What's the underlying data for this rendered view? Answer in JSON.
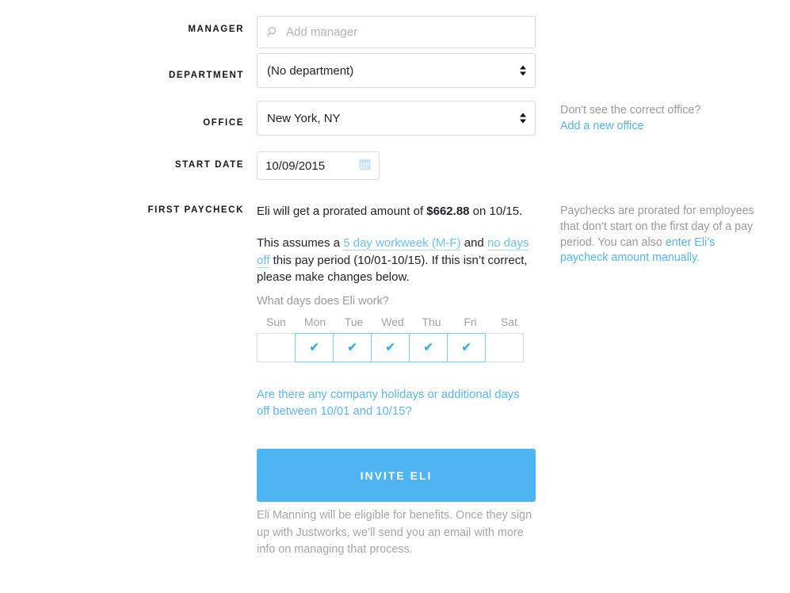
{
  "form": {
    "manager": {
      "label": "MANAGER",
      "placeholder": "Add manager",
      "value": "",
      "icon": "search-icon"
    },
    "department": {
      "label": "DEPARTMENT",
      "value": "(No department)",
      "options": [
        "(No department)"
      ]
    },
    "office": {
      "label": "OFFICE",
      "value": "New York, NY",
      "options": [
        "New York, NY"
      ],
      "helper_text": "Don't see the correct office?",
      "helper_link": "Add a new office"
    },
    "start_date": {
      "label": "START DATE",
      "value": "10/09/2015",
      "icon": "calendar-icon"
    },
    "first_paycheck": {
      "label": "FIRST PAYCHECK",
      "summary_prefix": "Eli will get a prorated amount of ",
      "summary_amount": "$662.88",
      "summary_suffix": " on 10/15.",
      "assumes_prefix": "This assumes a ",
      "workweek_link": "5 day workweek (M-F)",
      "assumes_mid": " and ",
      "daysoff_link": "no days off",
      "assumes_suffix": " this pay period (10/01-10/15). If this isn’t correct, please make changes below.",
      "helper_text_1": "Paychecks are prorated for employees that don’t start on the first day of a pay period. You can also ",
      "helper_link": "enter Eli’s paycheck amount manually.",
      "days_question": "What days does Eli work?",
      "days": [
        {
          "label": "Sun",
          "checked": false
        },
        {
          "label": "Mon",
          "checked": true
        },
        {
          "label": "Tue",
          "checked": true
        },
        {
          "label": "Wed",
          "checked": true
        },
        {
          "label": "Thu",
          "checked": true
        },
        {
          "label": "Fri",
          "checked": true
        },
        {
          "label": "Sat",
          "checked": false
        }
      ],
      "check_glyph": "✔",
      "holidays_link": "Are there any company holidays or additional days off between 10/01 and 10/15?"
    }
  },
  "submit": {
    "button_label": "INVITE ELI",
    "footnote": "Eli Manning will be eligible for benefits. Once they sign up with Justworks, we’ll send you an email with more info on managing that process."
  },
  "colors": {
    "accent": "#4fb4f2",
    "link": "#55b4f2",
    "muted": "#9a9a9a",
    "border": "#dcdcdc",
    "check": "#45aeef"
  }
}
